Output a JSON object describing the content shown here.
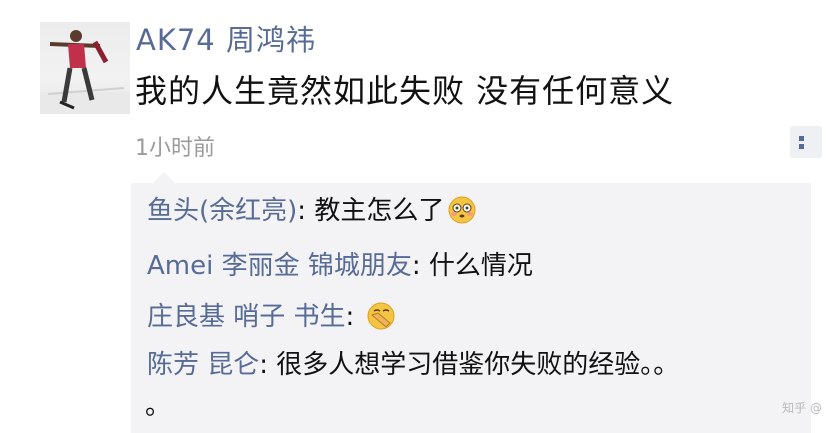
{
  "post": {
    "poster_name": "AK74 周鸿祎",
    "text": "我的人生竟然如此失败 没有任何意义",
    "time": "1小时前"
  },
  "comments": [
    {
      "name": "鱼头(余红亮)",
      "sep": ": ",
      "text": "教主怎么了",
      "emoji": "flushed-face-icon"
    },
    {
      "name": "Amei 李丽金 锦城朋友",
      "sep": ": ",
      "text": "什么情况"
    },
    {
      "name": "庄良基 哨子 书生",
      "sep": ": ",
      "text": "",
      "emoji": "facepalm-face-icon"
    },
    {
      "name": "陈芳 昆仑",
      "sep": ": ",
      "text": "很多人想学习借鉴你失败的经验。。",
      "continuation": "。"
    }
  ],
  "watermark": "知乎 @"
}
